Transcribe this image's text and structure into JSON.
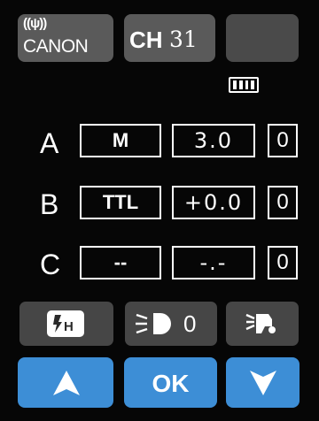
{
  "header": {
    "wireless_button": {
      "signal_glyph": "((ψ))",
      "label": "CANON"
    },
    "channel_button": {
      "prefix": "CH",
      "number": "31"
    }
  },
  "status": {
    "battery_level": 1.0,
    "battery_icon": "battery-full-icon"
  },
  "groups": [
    {
      "letter": "A",
      "mode": "M",
      "power": "3.0",
      "ratio": "0"
    },
    {
      "letter": "B",
      "mode": "TTL",
      "power": "+0.0",
      "ratio": "0"
    },
    {
      "letter": "C",
      "mode": "--",
      "power": "-.-",
      "ratio": "0"
    }
  ],
  "controls": {
    "hss_icon": "flash-hss-icon",
    "modeling_light_value": "0",
    "ok_label": "OK"
  },
  "colors": {
    "background": "#060606",
    "button_gray": "#5a5a5a",
    "accent_blue": "#3d8ed6"
  }
}
